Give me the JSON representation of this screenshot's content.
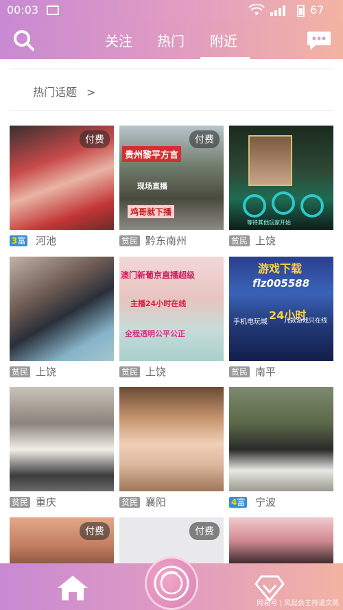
{
  "status": {
    "time": "00:03",
    "battery": "67"
  },
  "tabs": [
    {
      "label": "关注"
    },
    {
      "label": "热门"
    },
    {
      "label": "附近"
    }
  ],
  "active_tab": "附近",
  "topics": {
    "label": "热门话题",
    "arrow": ">"
  },
  "cards": [
    {
      "paid": "付费",
      "level": "3",
      "title": "富",
      "city": "河池",
      "rich": true
    },
    {
      "paid": "付费",
      "title": "贫民",
      "city": "黔东南州",
      "overlay": [
        "贵州黎平方言",
        "现场直播",
        "鸡哥就下播"
      ]
    },
    {
      "title": "贫民",
      "city": "上饶",
      "overlay": [
        "等待其他玩家开始"
      ]
    },
    {
      "title": "贫民",
      "city": "上饶"
    },
    {
      "title": "贫民",
      "city": "上饶",
      "overlay": [
        "澳门新葡京直播超级",
        "主播24小时在线",
        "全程透明公平公正"
      ]
    },
    {
      "title": "贫民",
      "city": "南平",
      "overlay": [
        "游戏下载",
        "flz005588",
        "手机电玩城",
        "24小时",
        "几款游戏只在线"
      ]
    },
    {
      "title": "贫民",
      "city": "重庆"
    },
    {
      "title": "贫民",
      "city": "襄阳"
    },
    {
      "level": "4",
      "title": "富",
      "city": "宁波",
      "rich": true
    },
    {
      "paid": "付费"
    },
    {
      "paid": "付费"
    },
    {}
  ],
  "watermark": "网易号 | 风起会主持道文苑",
  "colors": {
    "accent_start": "#c889d3",
    "accent_end": "#f3b3a3",
    "rich_badge": "#3a8fd4",
    "poor_badge": "#9a9a9a"
  }
}
